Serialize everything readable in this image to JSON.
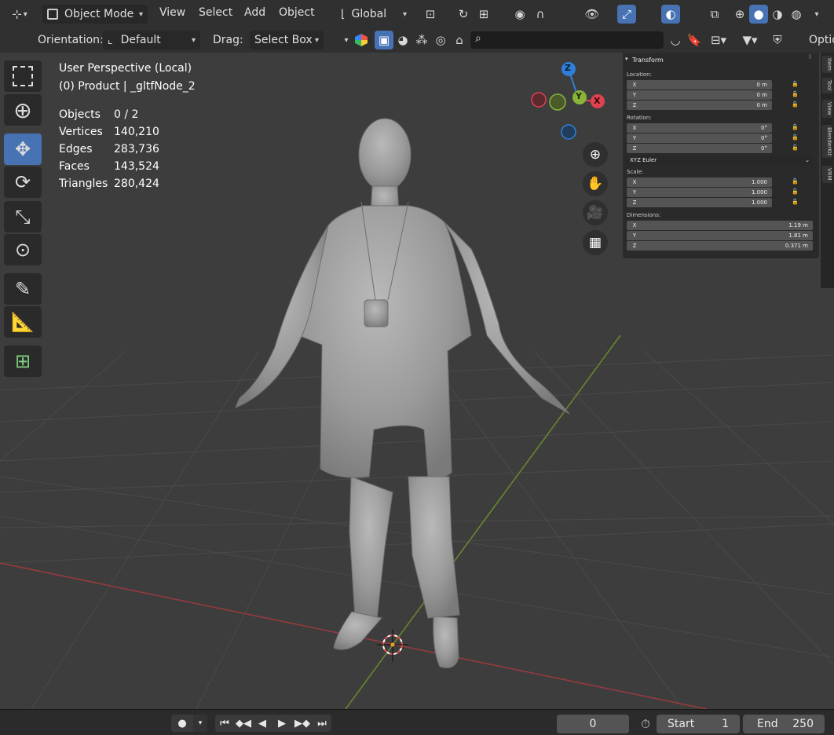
{
  "header": {
    "mode_label": "Object Mode",
    "menus": [
      "View",
      "Select",
      "Add",
      "Object"
    ],
    "transform_orientation": "Global",
    "orientation_label": "Orientation:",
    "orientation_value": "Default",
    "drag_label": "Drag:",
    "drag_value": "Select Box",
    "options_label": "Optio"
  },
  "viewport": {
    "perspective": "User Perspective (Local)",
    "object_info": "(0) Product | _gltfNode_2",
    "stats": [
      {
        "k": "Objects",
        "v": "0 / 2"
      },
      {
        "k": "Vertices",
        "v": "140,210"
      },
      {
        "k": "Edges",
        "v": "283,736"
      },
      {
        "k": "Faces",
        "v": "143,524"
      },
      {
        "k": "Triangles",
        "v": "280,424"
      }
    ],
    "gizmo": {
      "z": "Z",
      "y": "Y",
      "x": "X"
    }
  },
  "npanel": {
    "title": "Transform",
    "location_label": "Location:",
    "location": [
      {
        "ax": "X",
        "v": "0 m"
      },
      {
        "ax": "Y",
        "v": "0 m"
      },
      {
        "ax": "Z",
        "v": "0 m"
      }
    ],
    "rotation_label": "Rotation:",
    "rotation": [
      {
        "ax": "X",
        "v": "0°"
      },
      {
        "ax": "Y",
        "v": "0°"
      },
      {
        "ax": "Z",
        "v": "0°"
      }
    ],
    "rotation_mode": "XYZ Euler",
    "scale_label": "Scale:",
    "scale": [
      {
        "ax": "X",
        "v": "1.000"
      },
      {
        "ax": "Y",
        "v": "1.000"
      },
      {
        "ax": "Z",
        "v": "1.000"
      }
    ],
    "dimensions_label": "Dimensions:",
    "dimensions": [
      {
        "ax": "X",
        "v": "1.19 m"
      },
      {
        "ax": "Y",
        "v": "1.81 m"
      },
      {
        "ax": "Z",
        "v": "0.371 m"
      }
    ],
    "tabs": [
      "Item",
      "Tool",
      "View",
      "BlenderKit",
      "VRM"
    ]
  },
  "timeline": {
    "current_frame": "0",
    "start_label": "Start",
    "start_value": "1",
    "end_label": "End",
    "end_value": "250"
  },
  "colors": {
    "accent": "#4772b3",
    "axis_x": "#e0424f",
    "axis_y": "#8ab33a",
    "axis_z": "#2f7fd8"
  }
}
